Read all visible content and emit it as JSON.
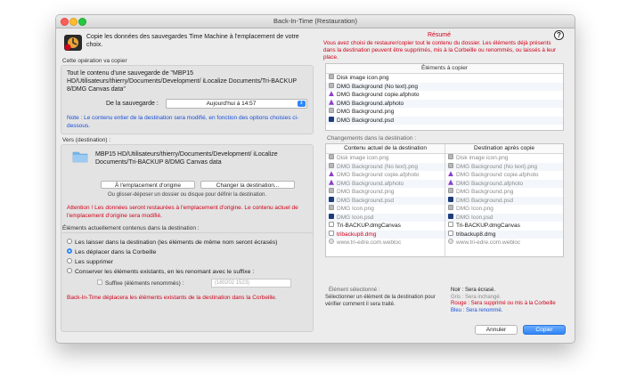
{
  "window": {
    "title": "Back-In-Time (Restauration)"
  },
  "intro": "Copie les données des sauvegardes Time Machine à l'emplacement de votre choix.",
  "copy_op": {
    "label": "Cette opération va copier",
    "description": "Tout le contenu d'une sauvegarde de \"MBP15 HD/Utilisateurs/thierry/Documents/Development/ iLocalize Documents/Tri-BACKUP 8/DMG Canvas data\"",
    "backup_label": "De la sauvegarde :",
    "backup_value": "Aujourd'hui à 14:57",
    "note": "Note : Le contenu entier de la destination sera modifié, en fonction des options choisies ci-dessous."
  },
  "dest": {
    "label": "Vers (destination) :",
    "path": "MBP15 HD/Utilisateurs/thierry/Documents/Development/ iLocalize Documents/Tri-BACKUP 8/DMG Canvas data",
    "btn_original": "À l'emplacement d'origine",
    "btn_change": "Changer la destination...",
    "hint": "Ou glisser-déposer un dossier ou disque pour définir la destination.",
    "warning": "Attention ! Les données seront restaurées à l'emplacement d'origine. Le contenu actuel de l'emplacement d'origine sera modifié."
  },
  "existing": {
    "label": "Éléments actuellement contenus dans la destination :",
    "options": [
      "Les laisser dans la destination (les éléments de même nom seront écrasés)",
      "Les déplacer dans la Corbeille",
      "Les supprimer",
      "Conserver les éléments existants, en les renomant avec le suffixe :"
    ],
    "selected_index": 1,
    "suffix_label": "Suffixe (éléments renommés) :",
    "suffix_placeholder": "(180202 1523)",
    "footer": "Back-In-Time déplacera les éléments existants de la destination dans la Corbeille."
  },
  "summary": {
    "title": "Résumé",
    "text": "Vous avez choisi de restaurer/copier tout le contenu du dossier. Les éléments déjà présents dans la destination peuvent être supprimés, mis à la Corbeille ou renommés, ou laissés à leur place.",
    "help": "?",
    "copy_header": "Éléments à copier",
    "copy_items": [
      {
        "name": "Disk image icon.png",
        "icon": "png"
      },
      {
        "name": "DMG Background (No text).png",
        "icon": "png"
      },
      {
        "name": "DMG Background copie.afphoto",
        "icon": "afphoto"
      },
      {
        "name": "DMG Background.afphoto",
        "icon": "afphoto"
      },
      {
        "name": "DMG Background.png",
        "icon": "png"
      },
      {
        "name": "DMG Background.psd",
        "icon": "psd"
      }
    ]
  },
  "changes": {
    "label": "Changements dans la destination :",
    "col_current": "Contenu actuel de la destination",
    "col_after": "Destination après copie",
    "current": [
      {
        "name": "Disk image icon.png",
        "icon": "png",
        "style": "faded"
      },
      {
        "name": "DMG Background (No text).png",
        "icon": "png",
        "style": "faded"
      },
      {
        "name": "DMG Background copie.afphoto",
        "icon": "afphoto",
        "style": "faded"
      },
      {
        "name": "DMG Background.afphoto",
        "icon": "afphoto",
        "style": "faded"
      },
      {
        "name": "DMG Background.png",
        "icon": "png",
        "style": "faded"
      },
      {
        "name": "DMG Background.psd",
        "icon": "psd",
        "style": "faded"
      },
      {
        "name": "DMG Icon.png",
        "icon": "png",
        "style": "faded"
      },
      {
        "name": "DMG Icon.psd",
        "icon": "psd",
        "style": "faded"
      },
      {
        "name": "Tri-BACKUP.dmgCanvas",
        "icon": "file",
        "style": "normal"
      },
      {
        "name": "tribackup8.dmg",
        "icon": "file",
        "style": "red"
      },
      {
        "name": "www.tri-edre.com.webloc",
        "icon": "webloc",
        "style": "faded"
      }
    ],
    "after": [
      {
        "name": "Disk image icon.png",
        "icon": "png",
        "style": "faded"
      },
      {
        "name": "DMG Background (No text).png",
        "icon": "png",
        "style": "faded"
      },
      {
        "name": "DMG Background copie.afphoto",
        "icon": "afphoto",
        "style": "faded"
      },
      {
        "name": "DMG Background.afphoto",
        "icon": "afphoto",
        "style": "faded"
      },
      {
        "name": "DMG Background.png",
        "icon": "png",
        "style": "faded"
      },
      {
        "name": "DMG Background.psd",
        "icon": "psd",
        "style": "faded"
      },
      {
        "name": "DMG Icon.png",
        "icon": "png",
        "style": "faded"
      },
      {
        "name": "DMG Icon.psd",
        "icon": "psd",
        "style": "faded"
      },
      {
        "name": "Tri-BACKUP.dmgCanvas",
        "icon": "file",
        "style": "normal"
      },
      {
        "name": "tribackup8.dmg",
        "icon": "file",
        "style": "normal"
      },
      {
        "name": "www.tri-edre.com.webloc",
        "icon": "webloc",
        "style": "faded"
      }
    ]
  },
  "selected": {
    "label": "Élément sélectionné :",
    "text": "Sélectionner un élément de la destination pour vérifier comment il sera traité."
  },
  "legend": {
    "black": "Noir : Sera écrasé.",
    "gray": "Gris : Sera inchangé.",
    "red": "Rouge : Sera supprimé ou mis à la Corbeille",
    "blue": "Bleu : Sera renommé."
  },
  "buttons": {
    "cancel": "Annuler",
    "copy": "Copier"
  }
}
